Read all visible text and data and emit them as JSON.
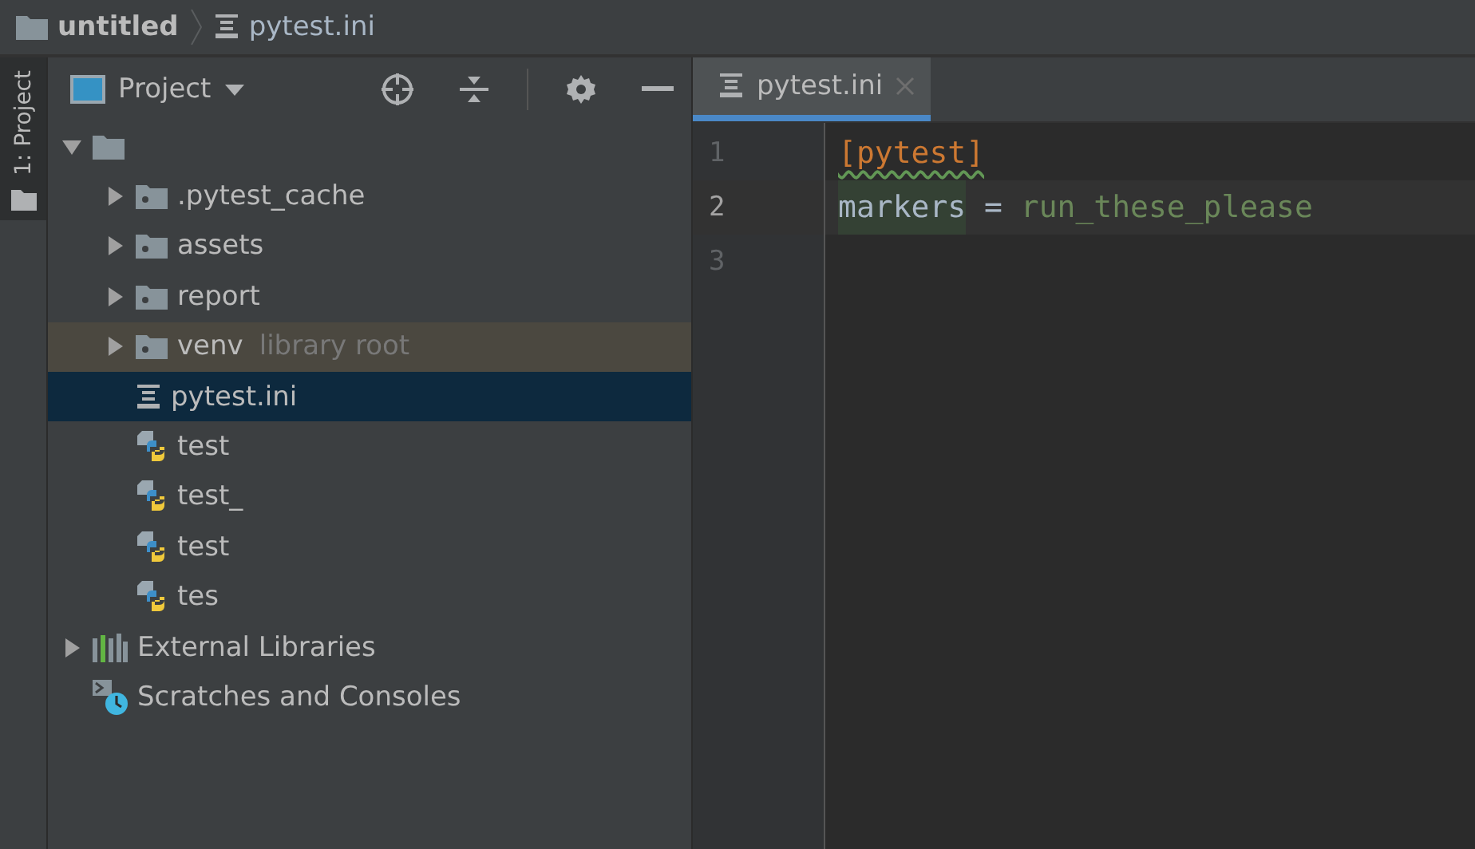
{
  "breadcrumb": [
    {
      "label": "untitled",
      "kind": "folder"
    },
    {
      "label": "pytest.ini",
      "kind": "ini"
    }
  ],
  "side_tabs": [
    {
      "label": "1: Project",
      "selected": true
    }
  ],
  "project_panel": {
    "title": "Project"
  },
  "tree": [
    {
      "kind": "folder",
      "expanded": true,
      "selected": false,
      "children": [
        {
          "kind": "folder",
          "label": ".pytest_cache",
          "expanded": false,
          "selected": false
        },
        {
          "kind": "folder",
          "label": "assets",
          "expanded": false,
          "selected": false
        },
        {
          "kind": "folder",
          "label": "report",
          "expanded": false,
          "selected": false
        },
        {
          "kind": "folder",
          "label": "venv",
          "hint": "library root",
          "expanded": false,
          "selected": false
        },
        {
          "kind": "ini",
          "label": "pytest.ini",
          "selected": true
        },
        {
          "kind": "python",
          "label": "test",
          "selected": false
        },
        {
          "kind": "python",
          "label": "test_",
          "selected": false
        },
        {
          "kind": "python",
          "label": "test",
          "selected": false
        },
        {
          "kind": "python",
          "label": "tes",
          "selected": false
        }
      ]
    },
    {
      "kind": "libraries",
      "label": "External Libraries",
      "expanded": false,
      "selected": false
    },
    {
      "kind": "scratches",
      "label": "Scratches and Consoles",
      "selected": false
    }
  ],
  "editor": {
    "tabs": [
      {
        "label": "pytest.ini",
        "selected": true
      }
    ],
    "lines": [
      {
        "number": "1",
        "current": false,
        "tokens": [
          {
            "text": "[pytest]",
            "kind": "section"
          }
        ]
      },
      {
        "number": "2",
        "current": true,
        "tokens": [
          {
            "text": "markers",
            "kind": "key"
          },
          {
            "text": " = ",
            "kind": "plain"
          },
          {
            "text": "run_these_please",
            "kind": "value"
          }
        ]
      },
      {
        "number": "3",
        "current": false
      }
    ]
  }
}
